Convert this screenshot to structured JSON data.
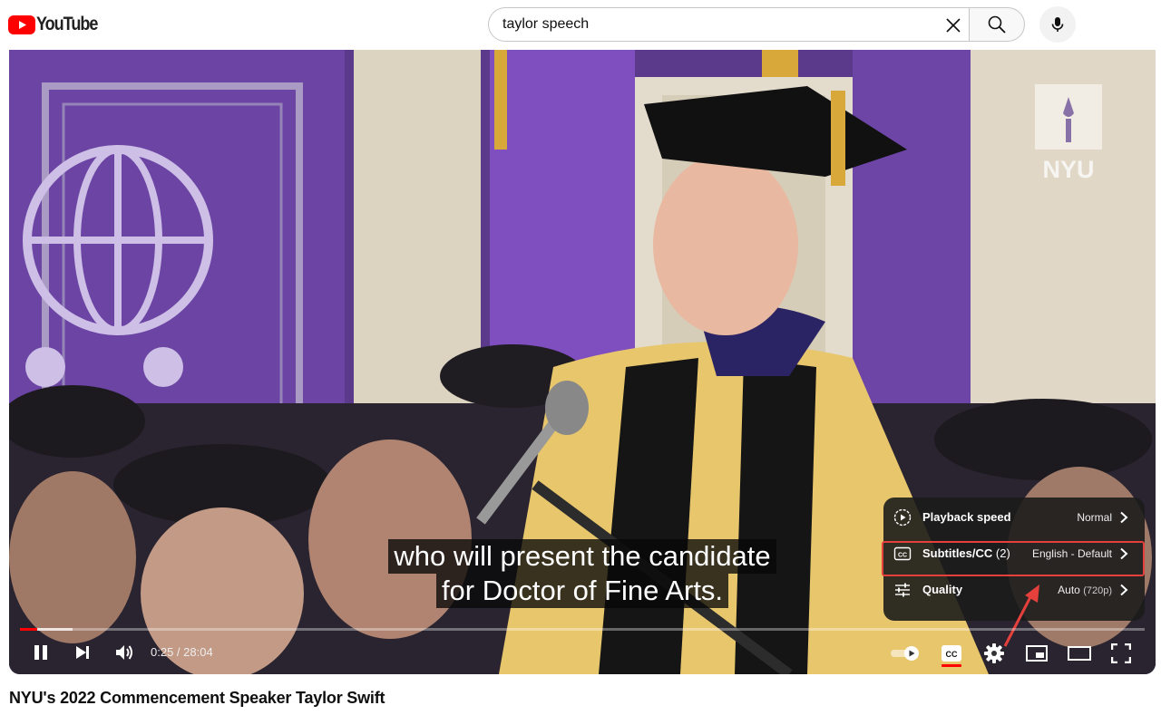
{
  "header": {
    "logo_text": "YouTube",
    "search": {
      "value": "taylor speech",
      "placeholder": "Search"
    },
    "colors": {
      "brand_red": "#ff0000"
    }
  },
  "player": {
    "subtitles": [
      "who will present the candidate",
      "for Doctor of Fine Arts."
    ],
    "watermark": "NYU",
    "time": {
      "current": "0:25",
      "total": "28:04",
      "display": "0:25 / 28:04"
    },
    "progress": {
      "played_fraction": 0.015,
      "buffered_fraction": 0.047
    },
    "controls": {
      "play_pause": "pause-icon",
      "next": "next-icon",
      "volume": "volume-icon",
      "autoplay": "autoplay-toggle",
      "captions": "cc-icon",
      "settings": "gear-icon",
      "miniplayer": "miniplayer-icon",
      "theater": "theater-icon",
      "fullscreen": "fullscreen-icon"
    },
    "settings_menu": {
      "items": [
        {
          "label": "Playback speed",
          "count": "",
          "value": "Normal",
          "value_sub": "",
          "icon": "playback-speed-icon"
        },
        {
          "label": "Subtitles/CC",
          "count": "(2)",
          "value": "English - Default",
          "value_sub": "",
          "icon": "subtitles-icon"
        },
        {
          "label": "Quality",
          "count": "",
          "value": "Auto",
          "value_sub": "(720p)",
          "icon": "quality-sliders-icon"
        }
      ],
      "highlighted_index": 1,
      "highlight_color": "#e5403c"
    }
  },
  "video": {
    "title": "NYU's 2022 Commencement Speaker Taylor Swift"
  }
}
